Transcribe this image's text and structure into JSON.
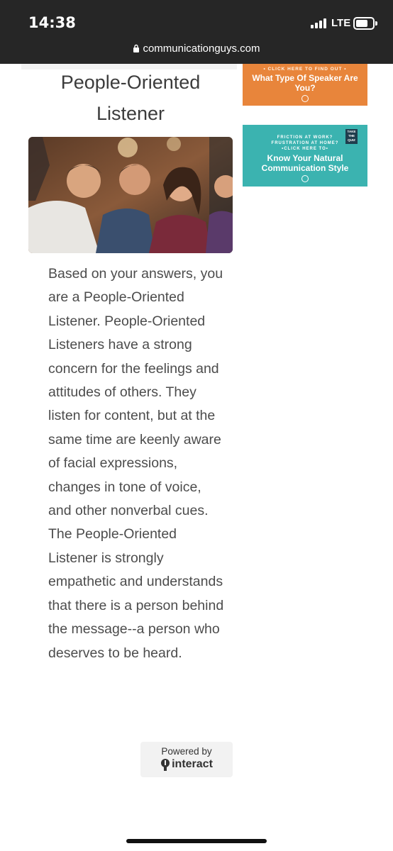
{
  "status_bar": {
    "time": "14:38",
    "network": "LTE"
  },
  "browser": {
    "url": "communicationguys.com"
  },
  "article": {
    "title": "People-Oriented Listener",
    "body": "Based on your answers, you are a People-Oriented Listener. People-Oriented Listeners have a strong concern for the feelings and attitudes of others. They listen for content, but at the same time are keenly aware of facial expressions, changes in tone of voice, and other nonverbal cues. The People-Oriented Listener is strongly empathetic and understands that there is a person behind the message--a person who deserves to be heard."
  },
  "ads": {
    "speaker": {
      "cta": "• CLICK HERE TO FIND OUT •",
      "headline": "What Type Of Speaker Are You?"
    },
    "style": {
      "line1": "FRICTION AT WORK?",
      "line2": "FRUSTRATION AT HOME?",
      "cta": "•CLICK HERE TO•",
      "headline": "Know Your Natural Communication Style",
      "badge": "TAKE THE QUIZ"
    }
  },
  "powered_by": {
    "label": "Powered by",
    "brand": "interact"
  },
  "colors": {
    "status_bar": "#262626",
    "ad_orange": "#e8853b",
    "ad_teal": "#3bb3b0"
  }
}
